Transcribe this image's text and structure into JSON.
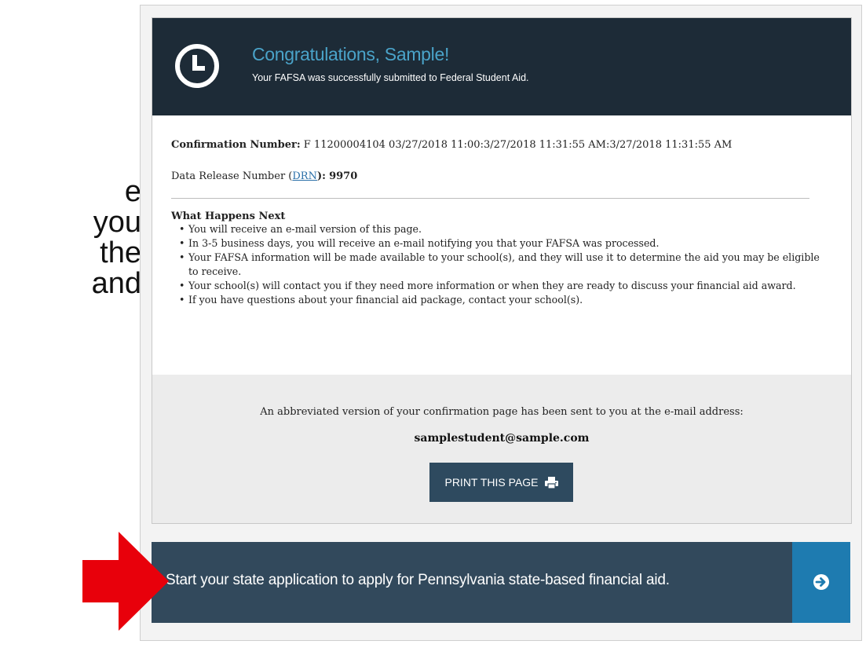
{
  "slide": {
    "left_text_lines": [
      "e",
      "you",
      "the",
      "and"
    ]
  },
  "header": {
    "title": "Congratulations, Sample!",
    "subtitle": "Your FAFSA was successfully submitted to Federal Student Aid."
  },
  "confirmation": {
    "label": "Confirmation Number:",
    "value": "F 11200004104 03/27/2018 11:00:3/27/2018 11:31:55 AM:3/27/2018 11:31:55 AM",
    "drn_prefix": "Data Release Number (",
    "drn_link": "DRN",
    "drn_suffix": "):",
    "drn_value": "9970"
  },
  "next": {
    "title": "What Happens Next",
    "items": [
      "You will receive an e-mail version of this page.",
      "In 3-5 business days, you will receive an e-mail notifying you that your FAFSA was processed.",
      "Your FAFSA information will be made available to your school(s), and they will use it to determine the aid you may be eligible to receive.",
      "Your school(s) will contact you if they need more information or when they are ready to discuss your financial aid award.",
      "If you have questions about your financial aid package, contact your school(s)."
    ]
  },
  "email": {
    "note": "An abbreviated version of your confirmation page has been sent to you at the e-mail address:",
    "address": "samplestudent@sample.com",
    "print_label": "PRINT THIS PAGE"
  },
  "state": {
    "text": "Start your state application to apply for Pennsylvania state-based financial aid."
  },
  "colors": {
    "header_bg": "#1d2b37",
    "title_accent": "#4aa3c9",
    "button_bg": "#2e4a5f",
    "state_bar_bg": "#32495c",
    "state_go_bg": "#1e7bb0",
    "arrow": "#e8000b"
  },
  "icons": {
    "header": "clock-icon",
    "print": "printer-icon",
    "state_go": "arrow-right-circle-icon",
    "pointer": "red-arrow-icon"
  }
}
